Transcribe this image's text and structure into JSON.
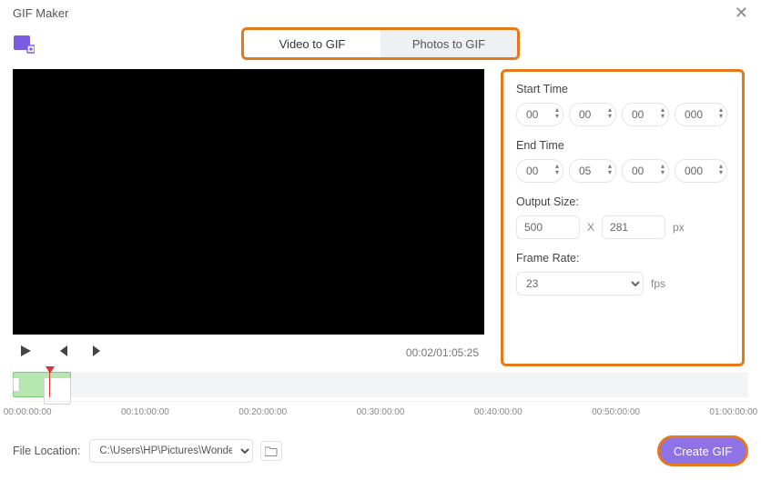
{
  "window": {
    "title": "GIF Maker"
  },
  "tabs": {
    "video": "Video to GIF",
    "photos": "Photos to GIF"
  },
  "panel": {
    "startTimeLabel": "Start Time",
    "endTimeLabel": "End Time",
    "start": {
      "hh": "00",
      "mm": "00",
      "ss": "00",
      "ms": "000"
    },
    "end": {
      "hh": "00",
      "mm": "05",
      "ss": "00",
      "ms": "000"
    },
    "outputSizeLabel": "Output Size:",
    "width": "500",
    "height": "281",
    "sizeSep": "X",
    "sizeUnit": "px",
    "frameRateLabel": "Frame Rate:",
    "frameRate": "23",
    "frUnit": "fps"
  },
  "playback": {
    "timecode": "00:02/01:05:25"
  },
  "timeline": {
    "ticks": [
      "00:00:00:00",
      "00:10:00:00",
      "00:20:00:00",
      "00:30:00:00",
      "00:40:00:00",
      "00:50:00:00",
      "01:00:00:00"
    ]
  },
  "footer": {
    "fileLocationLabel": "File Location:",
    "fileLocationValue": "C:\\Users\\HP\\Pictures\\Wondersh",
    "createLabel": "Create GIF"
  }
}
